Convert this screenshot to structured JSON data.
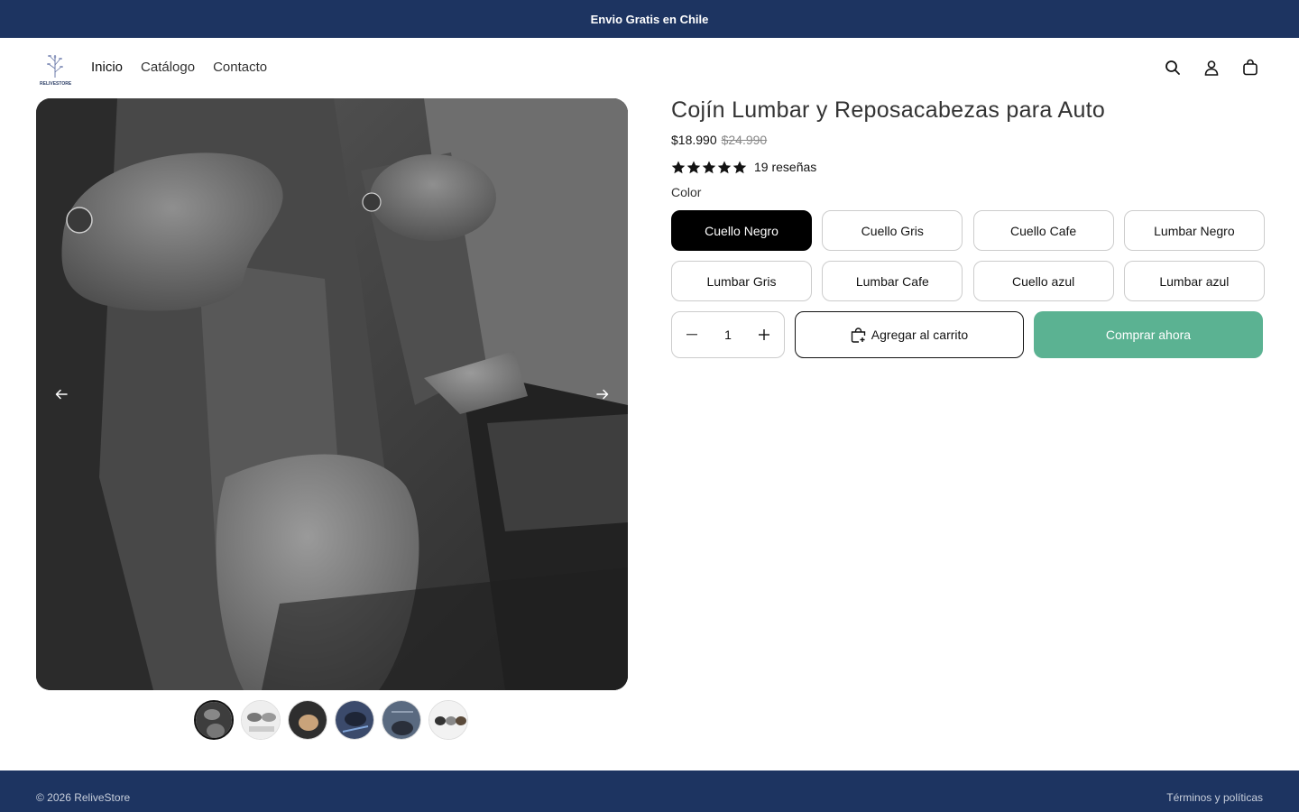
{
  "announcement": {
    "text": "Envio Gratis en Chile"
  },
  "header": {
    "logo_text": "RELIVESTORE",
    "nav": [
      {
        "label": "Inicio"
      },
      {
        "label": "Catálogo"
      },
      {
        "label": "Contacto"
      }
    ],
    "icons": [
      "search-icon",
      "account-icon",
      "cart-icon"
    ]
  },
  "product": {
    "title": "Cojín Lumbar y Reposacabezas para Auto",
    "price_sale": "$18.990",
    "price_compare": "$24.990",
    "rating_stars": 5,
    "reviews_label": "19 reseñas",
    "color_label": "Color",
    "variants": [
      {
        "label": "Cuello Negro",
        "selected": true
      },
      {
        "label": "Cuello Gris",
        "selected": false
      },
      {
        "label": "Cuello Cafe",
        "selected": false
      },
      {
        "label": "Lumbar Negro",
        "selected": false
      },
      {
        "label": "Lumbar Gris",
        "selected": false
      },
      {
        "label": "Lumbar Cafe",
        "selected": false
      },
      {
        "label": "Cuello azul",
        "selected": false
      },
      {
        "label": "Lumbar azul",
        "selected": false
      }
    ],
    "quantity": "1",
    "add_to_cart_label": "Agregar al carrito",
    "buy_now_label": "Comprar ahora",
    "buy_now_color": "#5bb292"
  },
  "gallery": {
    "thumbnail_count": 6,
    "active_thumbnail": 1
  },
  "footer": {
    "copyright": "© 2026 ReliveStore",
    "terms_label": "Términos y políticas"
  },
  "colors": {
    "brand_navy": "#1d3461",
    "accent_green": "#5bb292"
  }
}
